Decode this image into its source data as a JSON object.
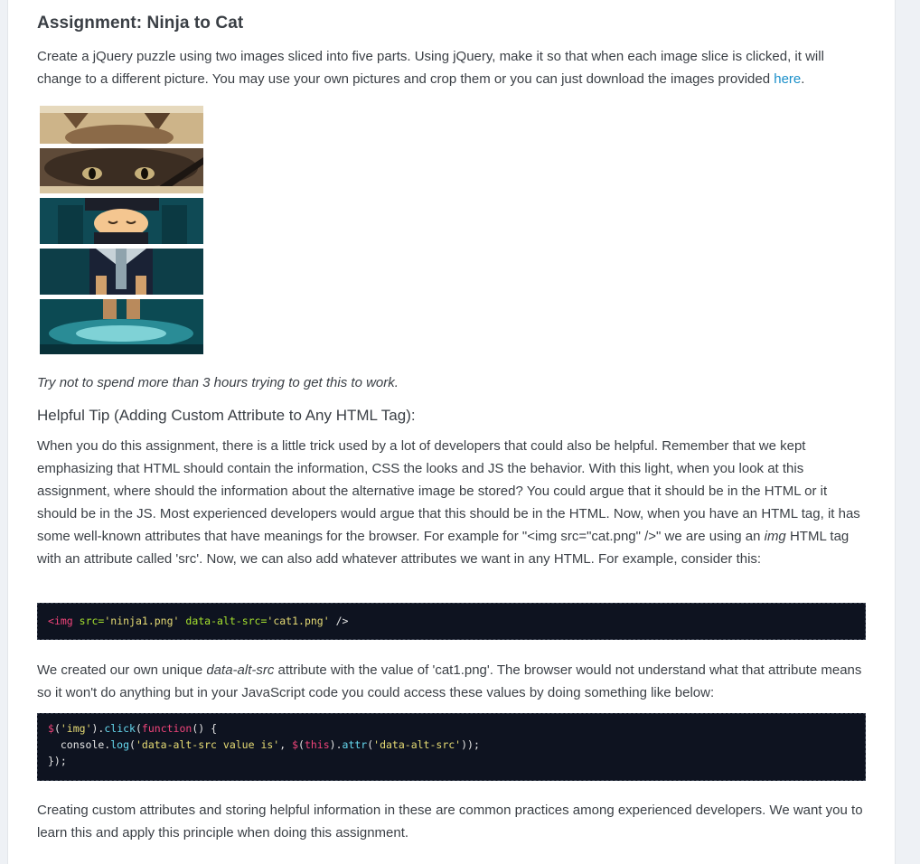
{
  "title": "Assignment: Ninja to Cat",
  "intro_text": "Create a jQuery puzzle using two images sliced into five parts. Using jQuery, make it so that when each image slice is clicked, it will change to a different picture. You may use your own pictures and crop them or you can just download the images provided",
  "intro_link": "here",
  "intro_end": ".",
  "time_note": "Try not to spend more than 3 hours trying to get this to work.",
  "tip_heading": "Helpful Tip (Adding Custom Attribute to Any HTML Tag):",
  "tip_text_1": "When you do this assignment, there is a little trick used by a lot of developers that could also be helpful. Remember that we kept emphasizing that HTML should contain the information, CSS the looks and JS the behavior. With this light, when you look at this assignment, where should the information about the alternative image be stored? You could argue that it should be in the HTML or it should be in the JS. Most experienced developers would argue that this should be in the HTML. Now, when you have an HTML tag, it has some well-known attributes that have meanings for the browser. For example for \"<img src=\"cat.png\" />\" we are using an",
  "tip_em": "img",
  "tip_text_2": "HTML tag with an attribute called 'src'. Now, we can also add whatever attributes we want in any HTML. For example, consider this:",
  "code1": {
    "open": "<",
    "tag": "img",
    "a1": "src=",
    "v1": "'ninja1.png'",
    "a2": "data-alt-src=",
    "v2": "'cat1.png'",
    "close": " />"
  },
  "para2_a": "We created our own unique",
  "para2_em": "data-alt-src",
  "para2_b": "attribute with the value of 'cat1.png'. The browser would not understand what that attribute means so it won't do anything but in your JavaScript code you could access these values by doing something like below:",
  "code2": {
    "l1_dollar": "$",
    "l1_a": "(",
    "l1_sel": "'img'",
    "l1_b": ").",
    "l1_click": "click",
    "l1_c": "(",
    "l1_fn": "function",
    "l1_d": "() {",
    "l2_console": "  console.",
    "l2_log": "log",
    "l2_a": "(",
    "l2_str": "'data-alt-src value is'",
    "l2_b": ", ",
    "l2_dollar": "$",
    "l2_c": "(",
    "l2_this": "this",
    "l2_d": ").",
    "l2_attr": "attr",
    "l2_e": "(",
    "l2_str2": "'data-alt-src'",
    "l2_f": "));",
    "l3": "});"
  },
  "para3": "Creating custom attributes and storing helpful information in these are common practices among experienced developers. We want you to learn this and apply this principle when doing this assignment."
}
